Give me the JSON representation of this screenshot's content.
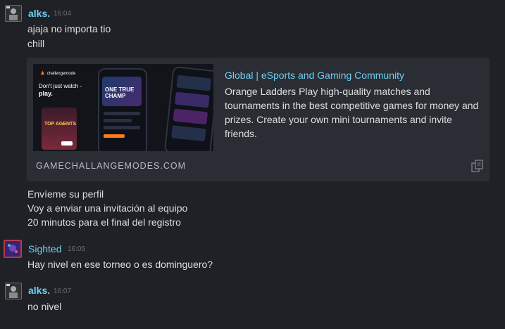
{
  "messages": [
    {
      "author": "alks.",
      "time": "16:04",
      "lines": [
        "ajaja no importa tio",
        "chill"
      ]
    },
    {
      "lines": [
        "Envíeme su perfil",
        "Voy a enviar una invitación al equipo",
        "20 minutos para el final del registro"
      ]
    },
    {
      "author": "Sighted",
      "time": "16:05",
      "lines": [
        "Hay nivel en ese torneo o es dominguero?"
      ]
    },
    {
      "author": "alks.",
      "time": "16:07",
      "lines": [
        "no nivel"
      ]
    }
  ],
  "embed": {
    "title": "Global | eSports and Gaming Community",
    "description": "Orange Ladders Play high-quality matches and tournaments in the best competitive games for money and prizes. Create your own mini tournaments and invite friends.",
    "domain": "GAMECHALLANGEMODES.COM",
    "thumb": {
      "logo": "challengemode",
      "tagline1": "Don't just watch -",
      "tagline2": "play.",
      "card_text": "TOP AGENTS",
      "hero_text": "ONE TRUE CHAMP"
    },
    "copy_icon": "copy-icon"
  },
  "colors": {
    "background": "#1f2126",
    "name": "#6dcff6",
    "text": "#dcdedf",
    "embed_bg": "#2a2d33"
  }
}
